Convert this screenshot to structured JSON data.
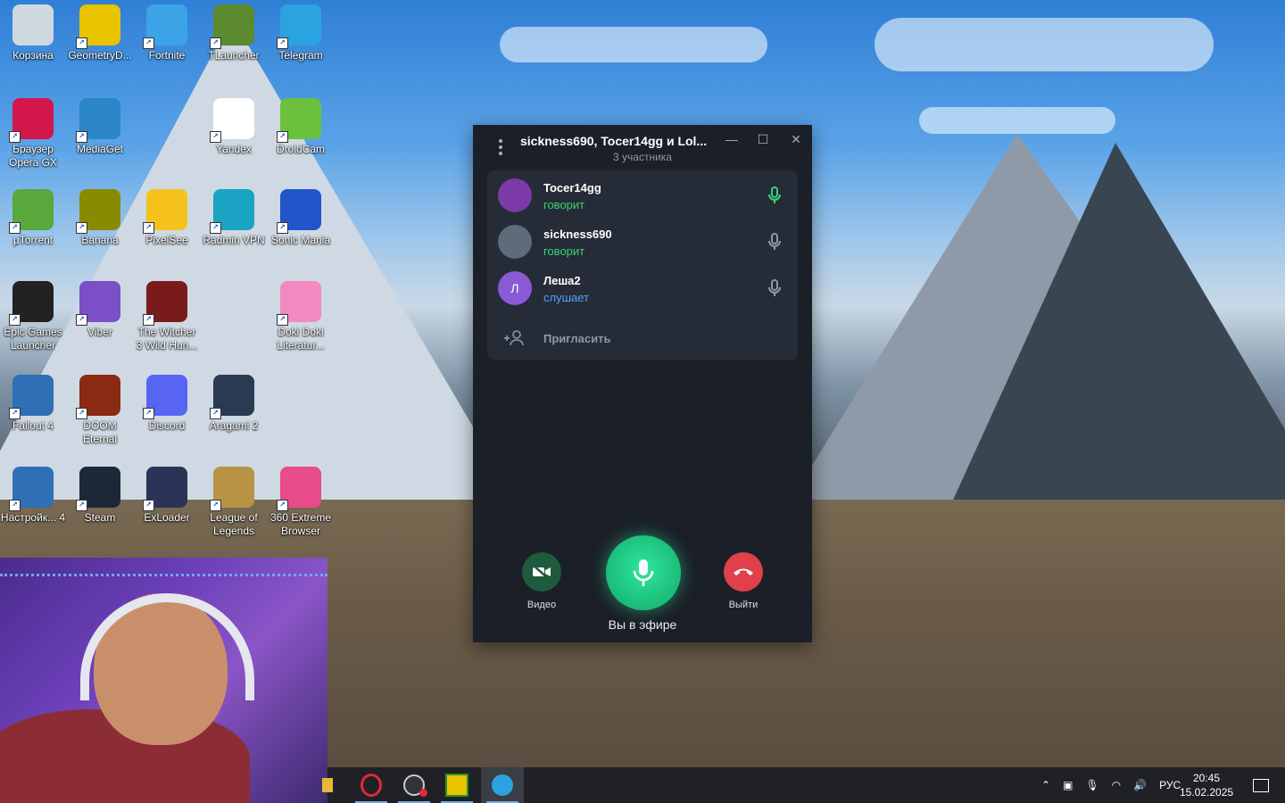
{
  "desktop": {
    "icons": [
      {
        "label": "Корзина",
        "icon": "recycle-bin-icon",
        "color": "#cfd8e0"
      },
      {
        "label": "GeometryD...",
        "icon": "geometry-dash-icon",
        "color": "#e8c300"
      },
      {
        "label": "Fortnite",
        "icon": "fortnite-icon",
        "color": "#3ba3e6"
      },
      {
        "label": "TLauncher",
        "icon": "tlauncher-icon",
        "color": "#5c8a2f"
      },
      {
        "label": "Telegram",
        "icon": "telegram-icon",
        "color": "#2aa3e0"
      },
      {
        "label": "Браузер Opera GX",
        "icon": "opera-gx-icon",
        "color": "#d3174a"
      },
      {
        "label": "MediaGet",
        "icon": "mediaget-icon",
        "color": "#2b86c8"
      },
      {
        "label": "Yandex",
        "icon": "yandex-icon",
        "color": "#ffffff"
      },
      {
        "label": "DroidCam",
        "icon": "droidcam-icon",
        "color": "#6bc13c"
      },
      {
        "label": "µTorrent",
        "icon": "utorrent-icon",
        "color": "#58a83c"
      },
      {
        "label": "Banana",
        "icon": "banana-icon",
        "color": "#8a8a00"
      },
      {
        "label": "PixelSee",
        "icon": "pixelsee-icon",
        "color": "#f4c21a"
      },
      {
        "label": "Radmin VPN",
        "icon": "radmin-vpn-icon",
        "color": "#1aa3c2"
      },
      {
        "label": "Sonic Mania",
        "icon": "sonic-mania-icon",
        "color": "#2155c9"
      },
      {
        "label": "Epic Games Launcher",
        "icon": "epic-games-icon",
        "color": "#222222"
      },
      {
        "label": "Viber",
        "icon": "viber-icon",
        "color": "#7b4fc6"
      },
      {
        "label": "The Witcher 3 Wild Hun...",
        "icon": "witcher-icon",
        "color": "#7a1b1b"
      },
      {
        "label": "Doki Doki Literatur...",
        "icon": "doki-doki-icon",
        "color": "#f28ac1"
      },
      {
        "label": "Fallout 4",
        "icon": "fallout-icon",
        "color": "#2f6fb5"
      },
      {
        "label": "DOOM Eternal",
        "icon": "doom-icon",
        "color": "#8a2a12"
      },
      {
        "label": "Discord",
        "icon": "discord-icon",
        "color": "#5865f2"
      },
      {
        "label": "Aragami 2",
        "icon": "aragami-icon",
        "color": "#2a3a52"
      },
      {
        "label": "Настройк... 4",
        "icon": "fallout-settings-icon",
        "color": "#2f6fb5"
      },
      {
        "label": "Steam",
        "icon": "steam-icon",
        "color": "#1b2838"
      },
      {
        "label": "ExLoader",
        "icon": "exloader-icon",
        "color": "#2a3456"
      },
      {
        "label": "League of Legends",
        "icon": "league-icon",
        "color": "#b89346"
      },
      {
        "label": "360 Extreme Browser",
        "icon": "360-browser-icon",
        "color": "#e84c8a"
      }
    ]
  },
  "call": {
    "title": "sickness690, Tocer14gg и Lol...",
    "participants_count": "3 участника",
    "participants": [
      {
        "name": "Tocer14gg",
        "status": "говорит",
        "status_color": "#3ad17a",
        "avatar": "",
        "avatar_color": "#7b3aa8",
        "mic_active": true
      },
      {
        "name": "sickness690",
        "status": "говорит",
        "status_color": "#3ad17a",
        "avatar": "",
        "avatar_color": "#5d6b7a",
        "mic_active": false
      },
      {
        "name": "Леша2",
        "status": "слушает",
        "status_color": "#4ea3ff",
        "avatar": "Л",
        "avatar_color": "#8a5ad6",
        "mic_active": false
      }
    ],
    "invite_label": "Пригласить",
    "video_label": "Видео",
    "leave_label": "Выйти",
    "on_air_label": "Вы в эфире",
    "colors": {
      "accent": "#1fc47f",
      "leave": "#e0404a",
      "video_bg": "#1e5a3c"
    }
  },
  "taskbar": {
    "apps": [
      "folder-icon",
      "opera-gx-icon",
      "obs-icon",
      "geometry-dash-icon",
      "telegram-icon"
    ],
    "active_app": "telegram-icon",
    "language": "РУС",
    "time": "20:45",
    "date": "15.02.2025"
  }
}
